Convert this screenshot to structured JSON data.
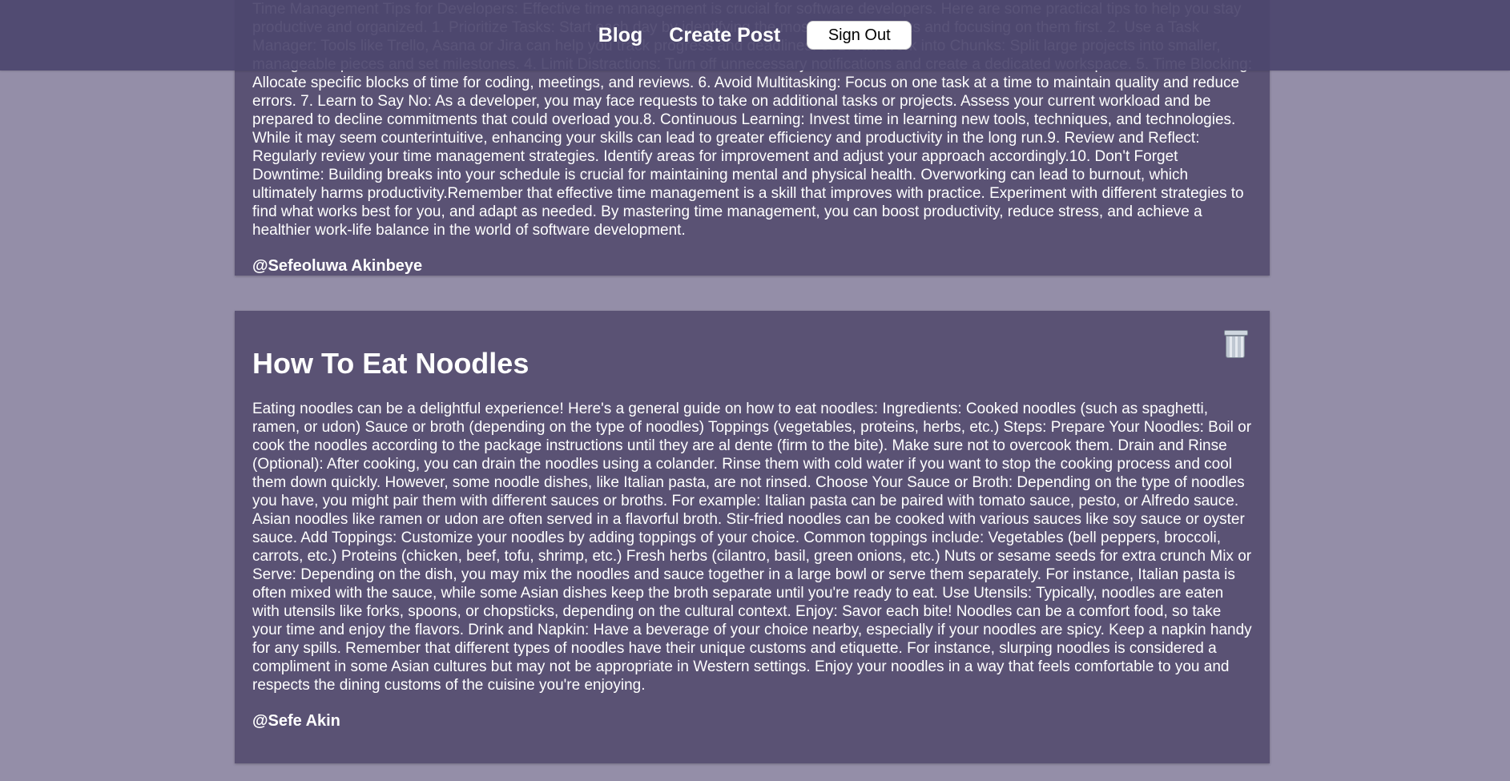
{
  "nav": {
    "blog": "Blog",
    "create_post": "Create Post",
    "sign_out": "Sign Out"
  },
  "posts": [
    {
      "body": "Time Management Tips for Developers: Effective time management is crucial for software developers. Here are some practical tips to help you stay productive and organized. 1. Prioritize Tasks: Start each day by identifying the most important tasks and focusing on them first. 2. Use a Task Manager: Tools like Trello, Asana or Jira can help you track progress and deadlines. 3. Break Work into Chunks: Split large projects into smaller, manageable pieces and set milestones. 4. Limit Distractions: Turn off unnecessary notifications and create a dedicated workspace. 5. Time Blocking: Allocate specific blocks of time for coding, meetings, and reviews. 6. Avoid Multitasking: Focus on one task at a time to maintain quality and reduce errors. 7. Learn to Say No: As a developer, you may face requests to take on additional tasks or projects. Assess your current workload and be prepared to decline commitments that could overload you.8. Continuous Learning: Invest time in learning new tools, techniques, and technologies. While it may seem counterintuitive, enhancing your skills can lead to greater efficiency and productivity in the long run.9. Review and Reflect: Regularly review your time management strategies. Identify areas for improvement and adjust your approach accordingly.10. Don't Forget Downtime: Building breaks into your schedule is crucial for maintaining mental and physical health. Overworking can lead to burnout, which ultimately harms productivity.Remember that effective time management is a skill that improves with practice. Experiment with different strategies to find what works best for you, and adapt as needed. By mastering time management, you can boost productivity, reduce stress, and achieve a healthier work-life balance in the world of software development.",
      "author": "@Sefeoluwa Akinbeye"
    },
    {
      "title": "How To Eat Noodles",
      "body": "Eating noodles can be a delightful experience! Here's a general guide on how to eat noodles: Ingredients: Cooked noodles (such as spaghetti, ramen, or udon) Sauce or broth (depending on the type of noodles) Toppings (vegetables, proteins, herbs, etc.) Steps: Prepare Your Noodles: Boil or cook the noodles according to the package instructions until they are al dente (firm to the bite). Make sure not to overcook them. Drain and Rinse (Optional): After cooking, you can drain the noodles using a colander. Rinse them with cold water if you want to stop the cooking process and cool them down quickly. However, some noodle dishes, like Italian pasta, are not rinsed. Choose Your Sauce or Broth: Depending on the type of noodles you have, you might pair them with different sauces or broths. For example: Italian pasta can be paired with tomato sauce, pesto, or Alfredo sauce. Asian noodles like ramen or udon are often served in a flavorful broth. Stir-fried noodles can be cooked with various sauces like soy sauce or oyster sauce. Add Toppings: Customize your noodles by adding toppings of your choice. Common toppings include: Vegetables (bell peppers, broccoli, carrots, etc.) Proteins (chicken, beef, tofu, shrimp, etc.) Fresh herbs (cilantro, basil, green onions, etc.) Nuts or sesame seeds for extra crunch Mix or Serve: Depending on the dish, you may mix the noodles and sauce together in a large bowl or serve them separately. For instance, Italian pasta is often mixed with the sauce, while some Asian dishes keep the broth separate until you're ready to eat. Use Utensils: Typically, noodles are eaten with utensils like forks, spoons, or chopsticks, depending on the cultural context. Enjoy: Savor each bite! Noodles can be a comfort food, so take your time and enjoy the flavors. Drink and Napkin: Have a beverage of your choice nearby, especially if your noodles are spicy. Keep a napkin handy for any spills. Remember that different types of noodles have their unique customs and etiquette. For instance, slurping noodles is considered a compliment in some Asian cultures but may not be appropriate in Western settings. Enjoy your noodles in a way that feels comfortable to you and respects the dining customs of the cuisine you're enjoying.",
      "author": "@Sefe Akin",
      "delete_icon": "trash-can-icon"
    }
  ]
}
